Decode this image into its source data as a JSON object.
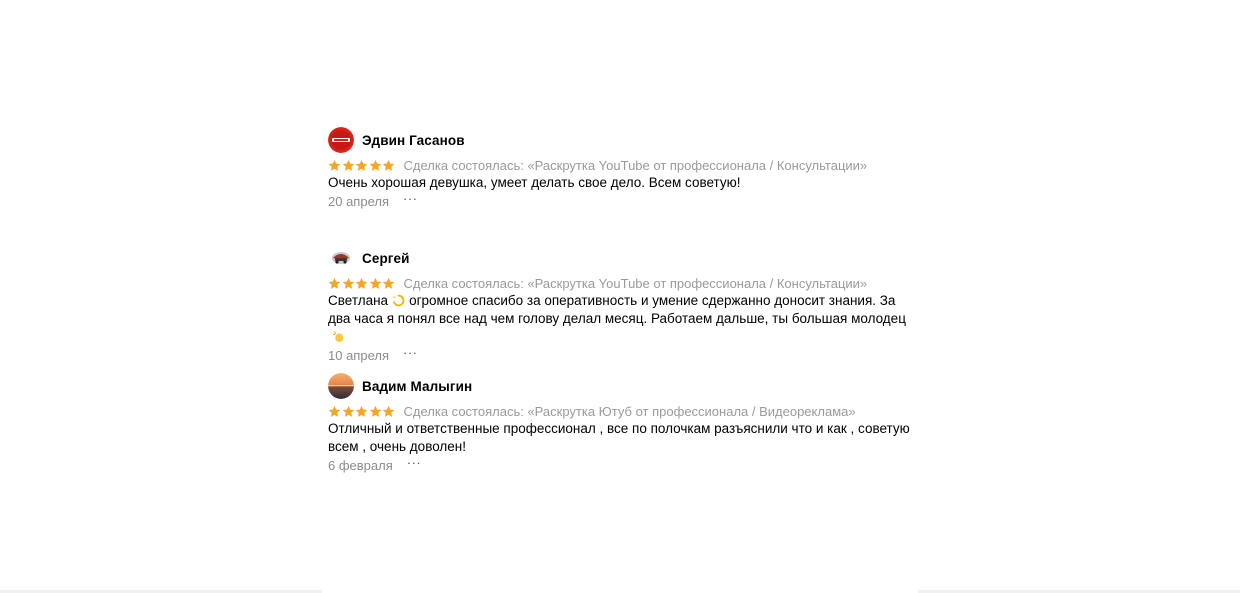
{
  "colors": {
    "star": "#f5a623",
    "meta_text": "#9a9a9a",
    "date_text": "#8c8c8c"
  },
  "reviews": [
    {
      "author": "Эдвин Гасанов",
      "avatar": "red-logo-avatar",
      "rating": 5,
      "deal": "Сделка состоялась: «Раскрутка YouTube от профессионала / Консультации»",
      "text_parts": [
        "Очень хорошая девушка, умеет делать свое дело. Всем советую!"
      ],
      "date": "20 апреля",
      "more": "···"
    },
    {
      "author": "Сергей",
      "avatar": "car-emblem-avatar",
      "rating": 5,
      "deal": "Сделка состоялась: «Раскрутка YouTube от профессионала / Консультации»",
      "text_parts": [
        "Светлана",
        "огромное спасибо за оперативность и умение сдержанно доносит знания. За два часа я понял все над чем голову делал месяц. Работаем дальше, ты большая молодец"
      ],
      "emojis": [
        "dizzy-emoji",
        "clapping-hands-emoji"
      ],
      "date": "10 апреля",
      "more": "···"
    },
    {
      "author": "Вадим Малыгин",
      "avatar": "sunset-photo-avatar",
      "rating": 5,
      "deal": "Сделка состоялась: «Раскрутка Ютуб от профессионала / Видеореклама»",
      "text_parts": [
        "Отличный и ответственные профессионал , все по полочкам разъяснили что и как , советую всем , очень доволен!"
      ],
      "date": "6 февраля",
      "more": "···"
    }
  ]
}
